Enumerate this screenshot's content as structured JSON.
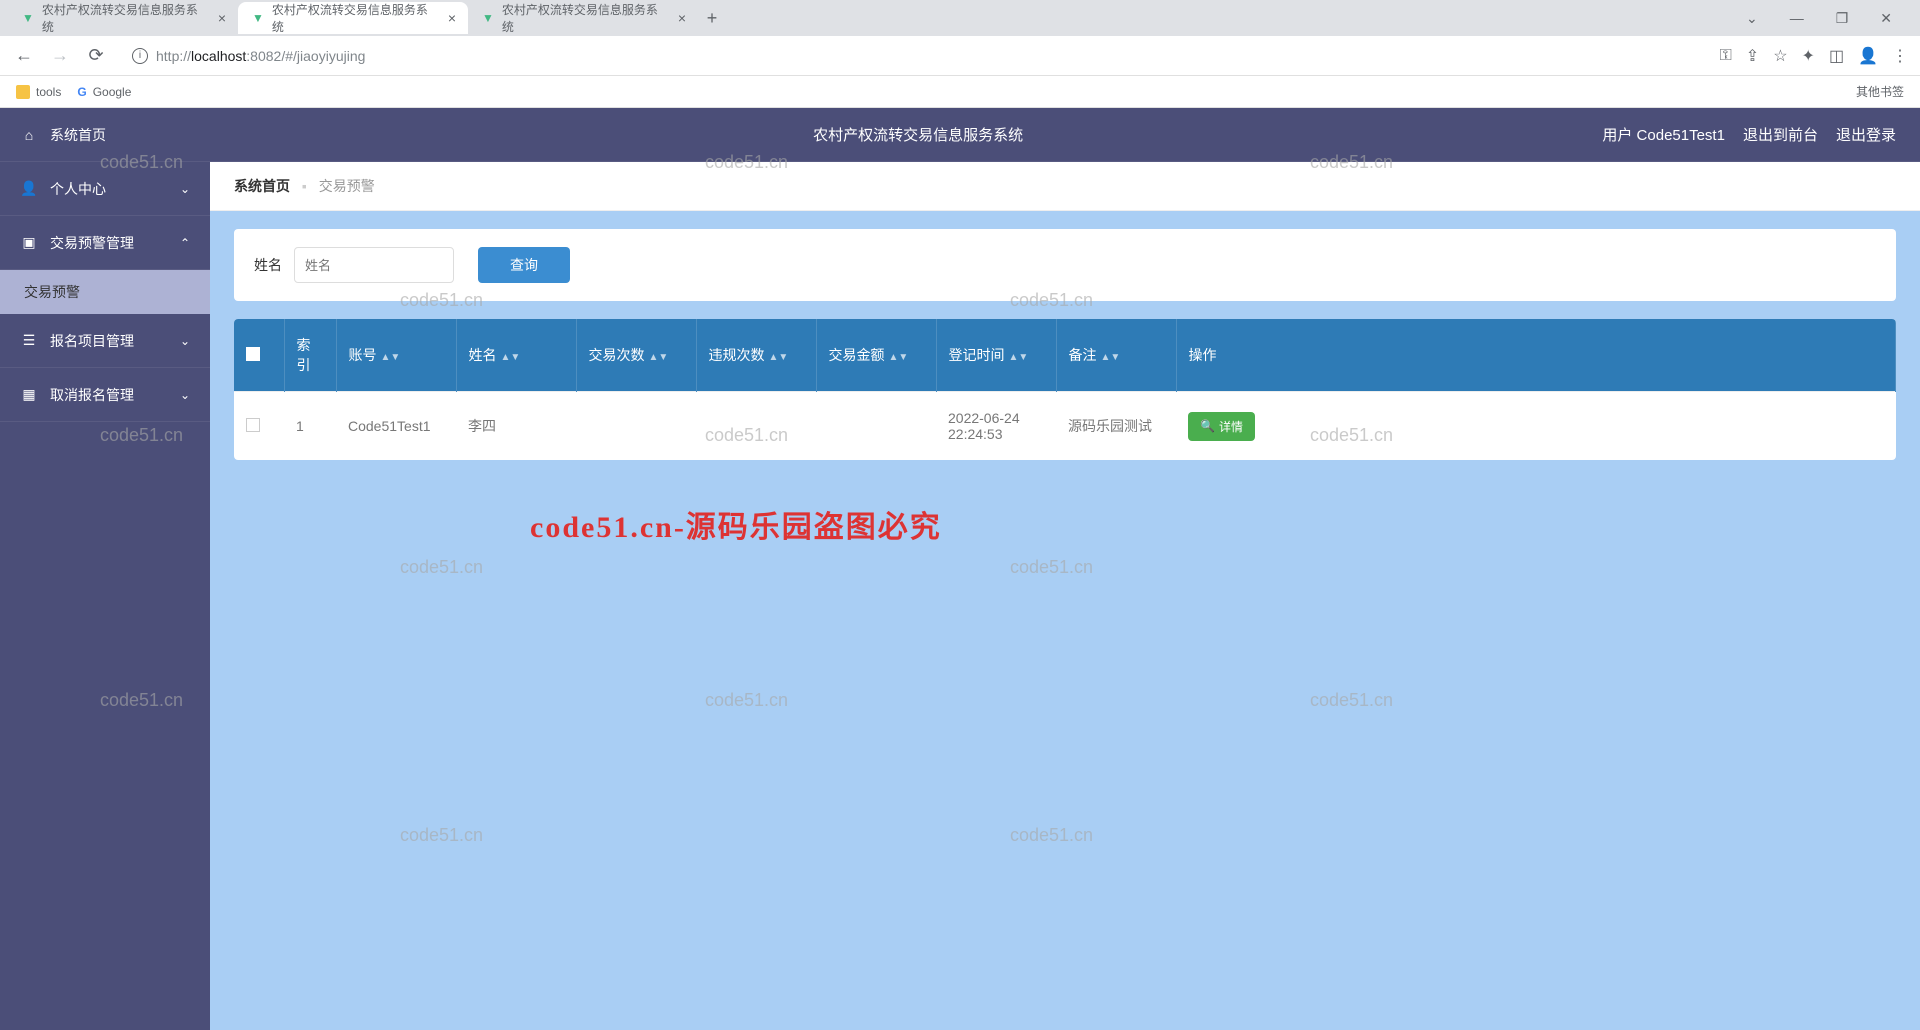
{
  "browser": {
    "tabs": [
      {
        "title": "农村产权流转交易信息服务系统"
      },
      {
        "title": "农村产权流转交易信息服务系统"
      },
      {
        "title": "农村产权流转交易信息服务系统"
      }
    ],
    "active_tab": 1,
    "url_host": "localhost",
    "url_port": ":8082",
    "url_path": "/#/jiaoyiyujing",
    "bookmarks": {
      "tools": "tools",
      "google": "Google",
      "other": "其他书签"
    }
  },
  "header": {
    "system_title": "农村产权流转交易信息服务系统",
    "user_label": "用户",
    "username": "Code51Test1",
    "exit_front": "退出到前台",
    "logout": "退出登录"
  },
  "sidebar": {
    "items": [
      {
        "label": "系统首页",
        "icon": "home",
        "expandable": false
      },
      {
        "label": "个人中心",
        "icon": "user",
        "expandable": true,
        "expanded": false
      },
      {
        "label": "交易预警管理",
        "icon": "chat",
        "expandable": true,
        "expanded": true,
        "children": [
          {
            "label": "交易预警"
          }
        ]
      },
      {
        "label": "报名项目管理",
        "icon": "list",
        "expandable": true,
        "expanded": false
      },
      {
        "label": "取消报名管理",
        "icon": "grid",
        "expandable": true,
        "expanded": false
      }
    ]
  },
  "breadcrumb": {
    "home": "系统首页",
    "current": "交易预警"
  },
  "search": {
    "name_label": "姓名",
    "name_placeholder": "姓名",
    "query_btn": "查询"
  },
  "table": {
    "columns": [
      "",
      "索引",
      "账号",
      "姓名",
      "交易次数",
      "违规次数",
      "交易金额",
      "登记时间",
      "备注",
      "操作"
    ],
    "rows": [
      {
        "index": "1",
        "account": "Code51Test1",
        "name": "李四",
        "txn_count": "",
        "violation_count": "",
        "txn_amount": "",
        "register_time": "2022-06-24 22:24:53",
        "remark": "源码乐园测试",
        "action": "详情"
      }
    ]
  },
  "watermarks": {
    "text": "code51.cn",
    "red": "code51.cn-源码乐园盗图必究"
  }
}
